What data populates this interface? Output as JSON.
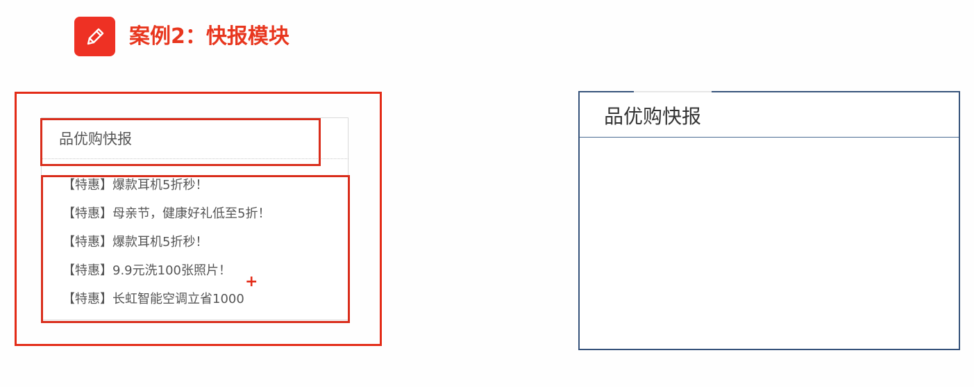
{
  "header": {
    "icon": "pencil-edit-icon",
    "title": "案例2：快报模块",
    "accent_color": "#ee3124"
  },
  "demo": {
    "title": "品优购快报",
    "items": [
      "【特惠】爆款耳机5折秒！",
      "【特惠】母亲节，健康好礼低至5折！",
      "【特惠】爆款耳机5折秒！",
      "【特惠】9.9元洗100张照片！",
      "【特惠】长虹智能空调立省1000"
    ],
    "highlight_color": "#e32b17"
  },
  "target": {
    "title": "品优购快报",
    "border_color": "#35527a"
  },
  "cursor": {
    "icon": "crosshair-cursor-icon",
    "glyph": "+"
  }
}
